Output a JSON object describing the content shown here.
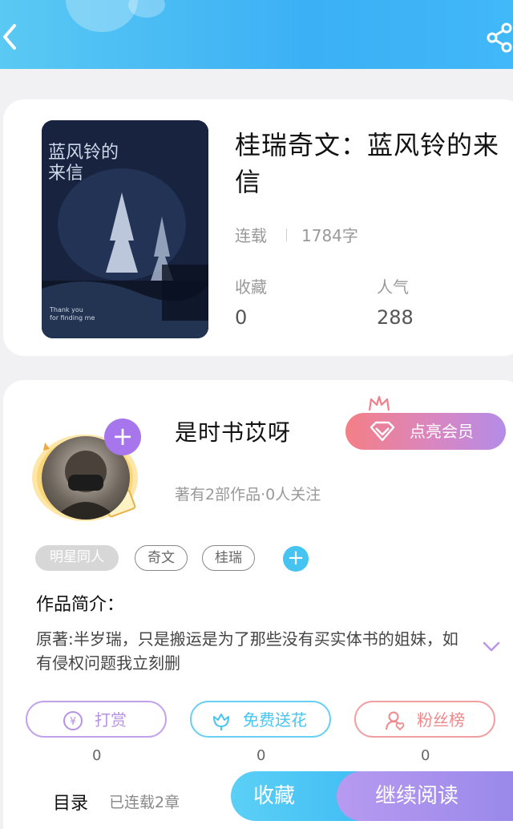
{
  "book": {
    "title": "桂瑞奇文：蓝风铃的来信",
    "status": "连载",
    "word_count": "1784字",
    "stats": [
      {
        "label": "收藏",
        "value": "0"
      },
      {
        "label": "人气",
        "value": "288"
      }
    ],
    "cover": {
      "title_text": "蓝风铃的来信",
      "subtitle_lines": [
        "Thank you",
        "for finding me"
      ]
    }
  },
  "author": {
    "name": "是时书苡呀",
    "works_info": "著有2部作品·0人关注",
    "vip_label": "点亮会员"
  },
  "tags": [
    "明星同人",
    "奇文",
    "桂瑞"
  ],
  "intro": {
    "heading": "作品简介：",
    "text": "原著:半岁瑞，只是搬运是为了那些没有买实体书的姐妹，如有侵权问题我立刻删"
  },
  "actions": [
    {
      "label": "打赏",
      "count": "0",
      "color": "#b592e6"
    },
    {
      "label": "免费送花",
      "count": "0",
      "color": "#48c5ef"
    },
    {
      "label": "粉丝榜",
      "count": "0",
      "color": "#ee8a8c"
    }
  ],
  "bottom": {
    "toc_label": "目录",
    "chapters": "已连载2章",
    "collect_label": "收藏",
    "continue_label": "继续阅读"
  }
}
